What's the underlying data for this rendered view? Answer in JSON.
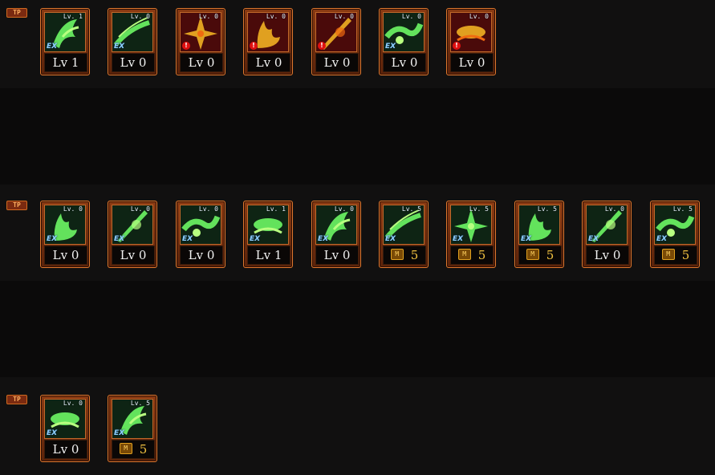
{
  "tp_badge": "TP",
  "rows": [
    {
      "skills": [
        {
          "level_tag": "Lv. 1",
          "label": "Lv 1",
          "master": false,
          "locked": false,
          "ex": true
        },
        {
          "level_tag": "Lv. 0",
          "label": "Lv 0",
          "master": false,
          "locked": false,
          "ex": true
        },
        {
          "level_tag": "Lv. 0",
          "label": "Lv 0",
          "master": false,
          "locked": true,
          "ex": false
        },
        {
          "level_tag": "Lv. 0",
          "label": "Lv 0",
          "master": false,
          "locked": true,
          "ex": false
        },
        {
          "level_tag": "Lv. 0",
          "label": "Lv 0",
          "master": false,
          "locked": true,
          "ex": false
        },
        {
          "level_tag": "Lv. 0",
          "label": "Lv 0",
          "master": false,
          "locked": false,
          "ex": true
        },
        {
          "level_tag": "Lv. 0",
          "label": "Lv 0",
          "master": false,
          "locked": true,
          "ex": false
        }
      ]
    },
    {
      "skills": [
        {
          "level_tag": "Lv. 0",
          "label": "Lv 0",
          "master": false,
          "locked": false,
          "ex": true
        },
        {
          "level_tag": "Lv. 0",
          "label": "Lv 0",
          "master": false,
          "locked": false,
          "ex": true
        },
        {
          "level_tag": "Lv. 0",
          "label": "Lv 0",
          "master": false,
          "locked": false,
          "ex": true
        },
        {
          "level_tag": "Lv. 1",
          "label": "Lv 1",
          "master": false,
          "locked": false,
          "ex": true
        },
        {
          "level_tag": "Lv. 0",
          "label": "Lv 0",
          "master": false,
          "locked": false,
          "ex": true
        },
        {
          "level_tag": "Lv. 5",
          "label": "5",
          "master": true,
          "locked": false,
          "ex": true
        },
        {
          "level_tag": "Lv. 5",
          "label": "5",
          "master": true,
          "locked": false,
          "ex": true
        },
        {
          "level_tag": "Lv. 5",
          "label": "5",
          "master": true,
          "locked": false,
          "ex": true
        },
        {
          "level_tag": "Lv. 0",
          "label": "Lv 0",
          "master": false,
          "locked": false,
          "ex": true
        },
        {
          "level_tag": "Lv. 5",
          "label": "5",
          "master": true,
          "locked": false,
          "ex": true
        }
      ]
    },
    {
      "skills": [
        {
          "level_tag": "Lv. 0",
          "label": "Lv 0",
          "master": false,
          "locked": false,
          "ex": true
        },
        {
          "level_tag": "Lv. 5",
          "label": "5",
          "master": true,
          "locked": false,
          "ex": true
        }
      ]
    }
  ],
  "ex_mark": "EX",
  "warn_mark": "!",
  "master_mark": "M",
  "colors": {
    "frame": "#e0782e",
    "master_text": "#f0c040",
    "icon_green": "#5fe05a",
    "locked_red": "#4a0a0a"
  }
}
